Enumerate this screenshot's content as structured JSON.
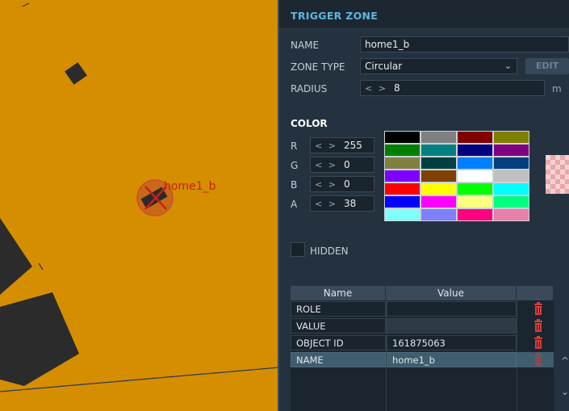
{
  "map": {
    "zone_label": "home1_b",
    "colors": {
      "ground": "#d58e00",
      "building": "#2b2b2b",
      "zone_fill": "#c04a2a",
      "zone_marker": "#cc1f1a"
    }
  },
  "panel": {
    "title": "TRIGGER ZONE",
    "name_label": "NAME",
    "name_value": "home1_b",
    "zone_type_label": "ZONE TYPE",
    "zone_type_value": "Circular",
    "edit_button": "EDIT",
    "radius_label": "RADIUS",
    "radius_value": "8",
    "radius_unit": "m",
    "color_title": "COLOR",
    "channels": [
      {
        "label": "R",
        "value": "255"
      },
      {
        "label": "G",
        "value": "0"
      },
      {
        "label": "B",
        "value": "0"
      },
      {
        "label": "A",
        "value": "38"
      }
    ],
    "palette": [
      "#000000",
      "#808080",
      "#800000",
      "#808000",
      "#008000",
      "#008080",
      "#000080",
      "#800080",
      "#808040",
      "#004040",
      "#0080ff",
      "#004080",
      "#8000ff",
      "#804000",
      "#ffffff",
      "#c0c0c0",
      "#ff0000",
      "#ffff00",
      "#00ff00",
      "#00ffff",
      "#0000ff",
      "#ff00ff",
      "#ffff80",
      "#00ff80",
      "#80ffff",
      "#8080ff",
      "#ff0080",
      "#e880a8"
    ],
    "hidden_label": "HIDDEN",
    "table": {
      "headers": [
        "Name",
        "Value"
      ],
      "rows": [
        {
          "name": "ROLE",
          "value": ""
        },
        {
          "name": "VALUE",
          "value": ""
        },
        {
          "name": "OBJECT ID",
          "value": "161875063"
        },
        {
          "name": "NAME",
          "value": "home1_b"
        }
      ],
      "selected_row": 3
    },
    "colors": {
      "accent": "#5fb6e0",
      "trash": "#d2413a",
      "selected_row": "#3f5d6e"
    }
  }
}
